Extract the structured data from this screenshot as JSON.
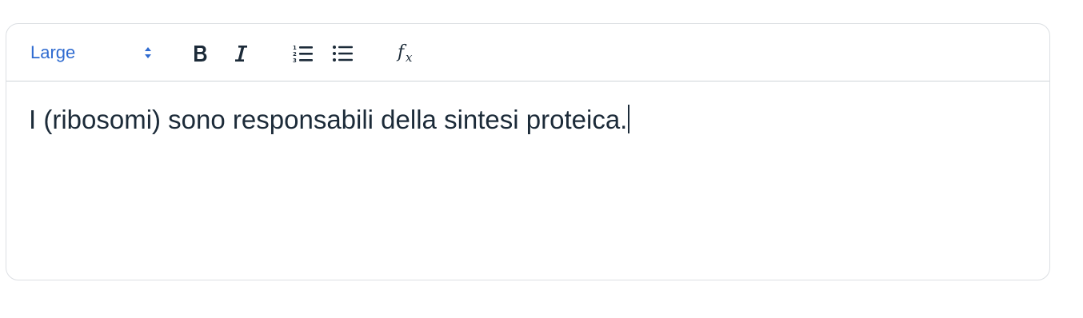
{
  "toolbar": {
    "font_size_value": "Large",
    "font_size_options": [
      "Large"
    ],
    "buttons": {
      "bold": "bold-icon",
      "italic": "italic-icon",
      "ordered_list": "ordered-list-icon",
      "unordered_list": "unordered-list-icon",
      "formula": "formula-icon"
    }
  },
  "editor": {
    "text": "I (ribosomi) sono responsabili della sintesi proteica."
  },
  "colors": {
    "accent": "#2f6bd0",
    "text": "#1c2b39",
    "border": "#dcdfe3"
  }
}
